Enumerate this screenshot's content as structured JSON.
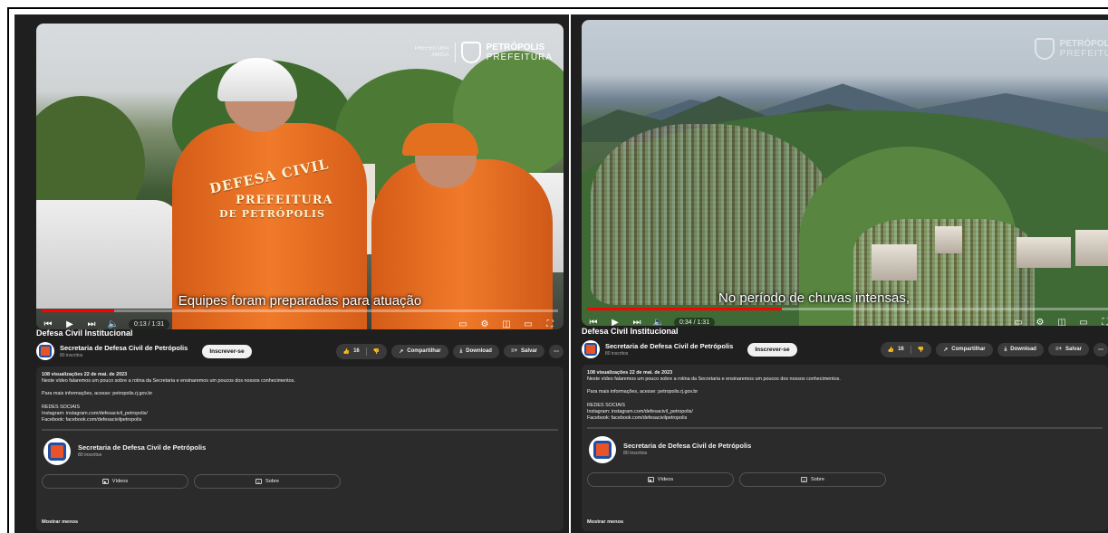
{
  "colors": {
    "accent": "#ff0000",
    "panel_bg": "#1f1f1f",
    "desc_bg": "#2b2b2b"
  },
  "panels": [
    {
      "video": {
        "subtitle": "Equipes foram preparadas para atuação",
        "time": "0:13 / 1:31",
        "progress": 0.14,
        "back_text_1": "DEFESA CIVIL",
        "back_text_2": "PREFEITURA",
        "back_text_3": "DE PETRÓPOLIS",
        "logo_name_1": "PETRÓPOLIS",
        "logo_name_2": "PREFEITURA"
      },
      "title": "Defesa Civil Institucional",
      "channel": {
        "name": "Secretaria de Defesa Civil de Petrópolis",
        "subs": "80 inscritos"
      },
      "subscribe_label": "Inscrever-se",
      "likes": "16",
      "share_label": "Compartilhar",
      "download_label": "Download",
      "save_label": "Salvar",
      "description": {
        "meta": "108 visualizações  22 de mai. de 2023",
        "line1": "Neste vídeo falaremos um pouco sobre a rotina da Secretaria e ensinaremos um poucos dos nossos conhecimentos.",
        "line2": "Para mais informações, acesse: petropolis.rj.gov.br",
        "line3": "REDES SOCIAIS",
        "line4": "Instagram: instagram.com/defesacivil_petropolis/",
        "line5": "Facebook: facebook.com/defesacivilpetropolis",
        "card_name": "Secretaria de Defesa Civil de Petrópolis",
        "card_subs": "80 inscritos",
        "videos_label": "Vídeos",
        "about_label": "Sobre",
        "show_less": "Mostrar menos"
      }
    },
    {
      "video": {
        "subtitle": "No período de chuvas intensas,",
        "time": "0:34 / 1:31",
        "progress": 0.37,
        "logo_name_1": "PETRÓPOLIS",
        "logo_name_2": "PREFEITURA"
      },
      "title": "Defesa Civil Institucional",
      "channel": {
        "name": "Secretaria de Defesa Civil de Petrópolis",
        "subs": "80 inscritos"
      },
      "subscribe_label": "Inscrever-se",
      "likes": "16",
      "share_label": "Compartilhar",
      "download_label": "Download",
      "save_label": "Salvar",
      "description": {
        "meta": "108 visualizações  22 de mai. de 2023",
        "line1": "Neste vídeo falaremos um pouco sobre a rotina da Secretaria e ensinaremos um poucos dos nossos conhecimentos.",
        "line2": "Para mais informações, acesse: petropolis.rj.gov.br",
        "line3": "REDES SOCIAIS",
        "line4": "Instagram: instagram.com/defesacivil_petropolis/",
        "line5": "Facebook: facebook.com/defesacivilpetropolis",
        "card_name": "Secretaria de Defesa Civil de Petrópolis",
        "card_subs": "80 inscritos",
        "videos_label": "Vídeos",
        "about_label": "Sobre",
        "show_less": "Mostrar menos"
      }
    }
  ]
}
